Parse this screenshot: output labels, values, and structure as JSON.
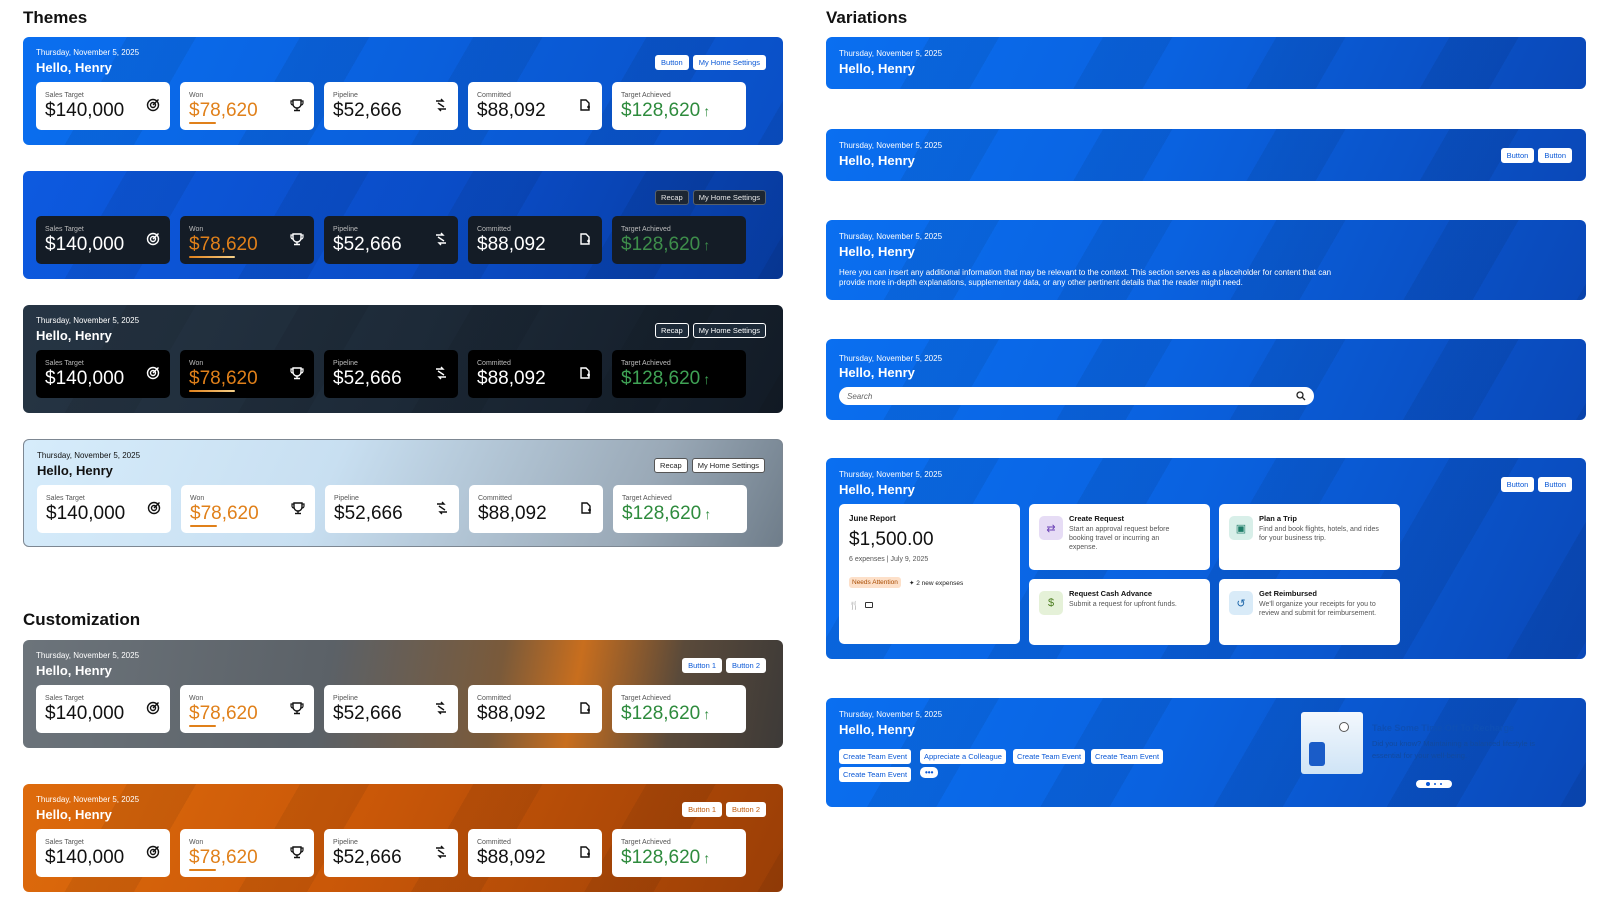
{
  "sections": {
    "themes": "Themes",
    "variations": "Variations",
    "customization": "Customization"
  },
  "greeting": {
    "date": "Thursday, November 5, 2025",
    "hello": "Hello, Henry"
  },
  "kpis": {
    "sales": {
      "label": "Sales Target",
      "value": "$140,000",
      "icon": "target-icon"
    },
    "won": {
      "label": "Won",
      "value": "$78,620",
      "icon": "trophy-icon"
    },
    "pipeline": {
      "label": "Pipeline",
      "value": "$52,666",
      "icon": "pipeline-arrows-icon"
    },
    "committed": {
      "label": "Committed",
      "value": "$88,092",
      "icon": "committed-doc-icon"
    },
    "achieved": {
      "label": "Target Achieved",
      "value": "$128,620",
      "icon": "arrow-up-icon"
    }
  },
  "buttons": {
    "button": "Button",
    "home_settings": "My Home Settings",
    "recap": "Recap",
    "button1": "Button 1",
    "button2": "Button 2"
  },
  "variations": {
    "description": "Here you can insert any additional information that may be relevant to the context. This section serves as a placeholder for content that can provide more in-depth explanations, supplementary data, or any other pertinent details that the reader might need.",
    "search_placeholder": "Search",
    "report": {
      "title": "June Report",
      "amount": "$1,500.00",
      "meta": "6 expenses | July 9, 2025",
      "badge": "Needs Attention",
      "new_expenses": "2 new expenses"
    },
    "tiles": [
      {
        "title": "Create Request",
        "desc": "Start an approval request before booking travel or incurring an expense.",
        "icon": "approval-icon"
      },
      {
        "title": "Plan a Trip",
        "desc": "Find and book flights, hotels, and rides for your business trip.",
        "icon": "briefcase-icon"
      },
      {
        "title": "Request Cash Advance",
        "desc": "Submit a request for upfront funds.",
        "icon": "cash-icon"
      },
      {
        "title": "Get Reimbursed",
        "desc": "We'll organize your receipts for you to review and submit for reimbursement.",
        "icon": "reimburse-icon"
      }
    ],
    "actions": [
      "Create Team Event",
      "Appreciate a Colleague",
      "Create Team Event",
      "Create Team Event",
      "Create Team Event"
    ],
    "more": "•••",
    "promo": {
      "title": "Take Some Time Off To Recharge",
      "text": "Did you know? Maintaining a balanced lifestyle is essential for your well-being."
    }
  },
  "colors": {
    "brand_blue": "#0a6ff0",
    "won_orange": "#e0801a",
    "achieved_green": "#2e8b3d",
    "orange_theme": "#de6b0c",
    "dark_theme": "#1d2a38"
  }
}
